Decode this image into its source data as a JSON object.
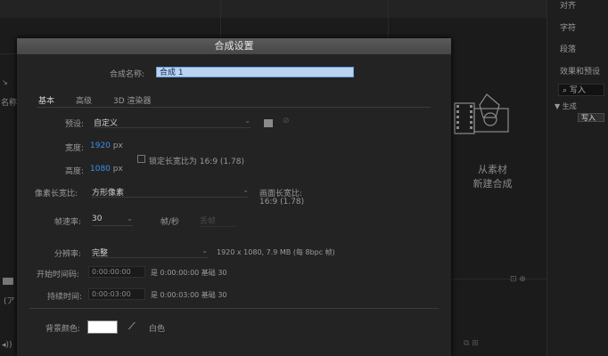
{
  "background": {
    "right_panel_items": [
      "对齐",
      "字符",
      "段落",
      "效果和预设"
    ],
    "search_value": "写入",
    "tree_label": "▼ 生成",
    "preset_chip": "写入",
    "new_comp_from_footage": [
      "从素材",
      "新建合成"
    ],
    "left_fragment": "名称"
  },
  "dialog": {
    "title": "合成设置",
    "comp_name_label": "合成名称:",
    "comp_name_value": "合成 1",
    "tabs": [
      "基本",
      "高级",
      "3D 渲染器"
    ],
    "active_tab": "基本",
    "preset_label": "预设:",
    "preset_value": "自定义",
    "width_label": "宽度:",
    "width_value": "1920",
    "width_unit": "px",
    "height_label": "高度:",
    "height_value": "1080",
    "height_unit": "px",
    "lock_aspect_label": "锁定长宽比为 16:9 (1.78)",
    "pixel_aspect_label": "像素长宽比:",
    "pixel_aspect_value": "方形像素",
    "frame_aspect_label": "画面长宽比:",
    "frame_aspect_value": "16:9 (1.78)",
    "frame_rate_label": "帧速率:",
    "frame_rate_value": "30",
    "frame_rate_unit": "帧/秒",
    "drop_frame_value": "丢帧",
    "resolution_label": "分辨率:",
    "resolution_value": "完整",
    "resolution_info": "1920 x 1080, 7.9 MB (每 8bpc 帧)",
    "start_timecode_label": "开始时间码:",
    "start_timecode_value": "0:00:00:00",
    "start_timecode_info": "是 0:00:00:00  基础 30",
    "duration_label": "持续时间:",
    "duration_value": "0:00:03:00",
    "duration_info": "是 0:00:03:00  基础 30",
    "bg_color_label": "背景颜色:",
    "bg_color_name": "白色"
  },
  "colors": {
    "accent_blue": "#3e8ee6",
    "bg_swatch": "#ffffff",
    "dialog_bg": "#232323"
  }
}
